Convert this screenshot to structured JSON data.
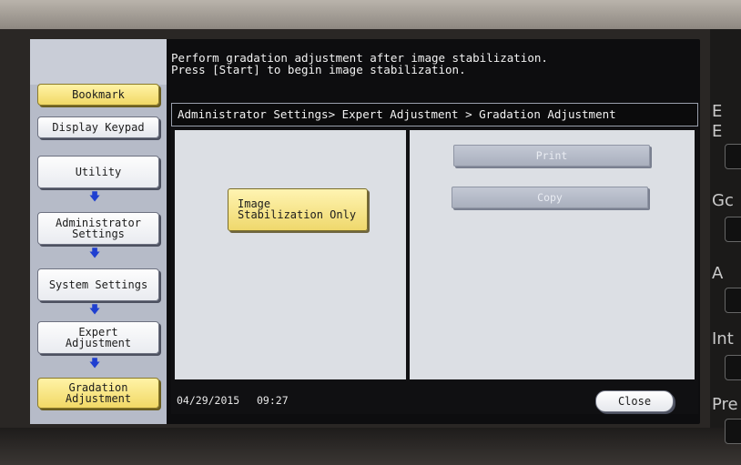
{
  "message": {
    "line1": "Perform gradation adjustment after image stabilization.",
    "line2": "Press [Start] to begin image stabilization."
  },
  "sidebar": {
    "bookmark": "Bookmark",
    "display_keypad": "Display Keypad",
    "flow": [
      {
        "label": "Utility"
      },
      {
        "label": "Administrator\nSettings"
      },
      {
        "label": "System Settings"
      },
      {
        "label": "Expert\nAdjustment"
      },
      {
        "label": "Gradation\nAdjustment"
      }
    ],
    "arrow_icon": "down-arrow-icon"
  },
  "breadcrumb": "Administrator Settings> Expert Adjustment > Gradation Adjustment",
  "main": {
    "image_stabilization": "Image\n Stabilization Only",
    "print": "Print",
    "copy": "Copy"
  },
  "status": {
    "date": "04/29/2015",
    "time": "09:27",
    "close": "Close"
  },
  "right_panel": {
    "labels": [
      "E",
      "E",
      "Gc",
      "A",
      "Int",
      "Pre"
    ]
  },
  "colors": {
    "selected_yellow": "#f1d866",
    "arrow_blue": "#1f3fd0",
    "disabled_gray": "#a9afbd"
  }
}
